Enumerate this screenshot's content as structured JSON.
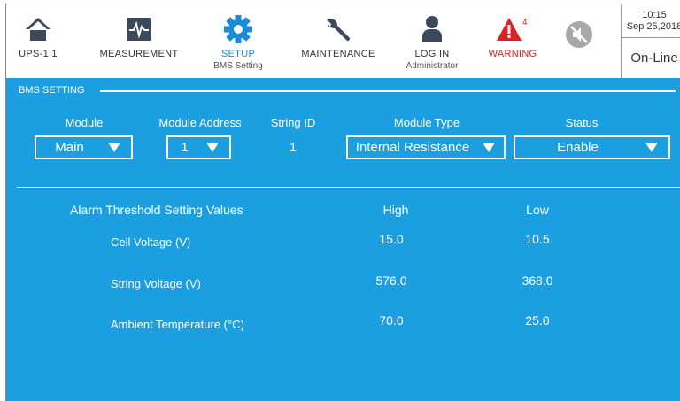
{
  "nav": {
    "ups": {
      "label": "UPS-1.1"
    },
    "measurement": {
      "label": "MEASUREMENT"
    },
    "setup": {
      "label": "SETUP",
      "sub": "BMS Setting"
    },
    "maintenance": {
      "label": "MAINTENANCE"
    },
    "login": {
      "label": "LOG IN",
      "sub": "Administrator"
    },
    "warning": {
      "label": "WARNING",
      "count": "4"
    }
  },
  "clock": {
    "time": "10:15",
    "date": "Sep 25,2018",
    "status": "On-Line"
  },
  "section": {
    "title": "BMS SETTING"
  },
  "fields": {
    "module": {
      "label": "Module",
      "value": "Main"
    },
    "module_address": {
      "label": "Module Address",
      "value": "1"
    },
    "string_id": {
      "label": "String ID",
      "value": "1"
    },
    "module_type": {
      "label": "Module Type",
      "value": "Internal Resistance"
    },
    "status": {
      "label": "Status",
      "value": "Enable"
    }
  },
  "thresholds": {
    "heading": "Alarm Threshold Setting Values",
    "high_label": "High",
    "low_label": "Low",
    "rows": [
      {
        "name": "Cell Voltage (V)",
        "high": "15.0",
        "low": "10.5"
      },
      {
        "name": "String Voltage (V)",
        "high": "576.0",
        "low": "368.0"
      },
      {
        "name": "Ambient Temperature (°C)",
        "high": "70.0",
        "low": "25.0"
      }
    ]
  },
  "colors": {
    "accent": "#1b9fe0",
    "setup_active": "#1a8bd8",
    "warning": "#e02020",
    "icon": "#3a4a5c"
  }
}
